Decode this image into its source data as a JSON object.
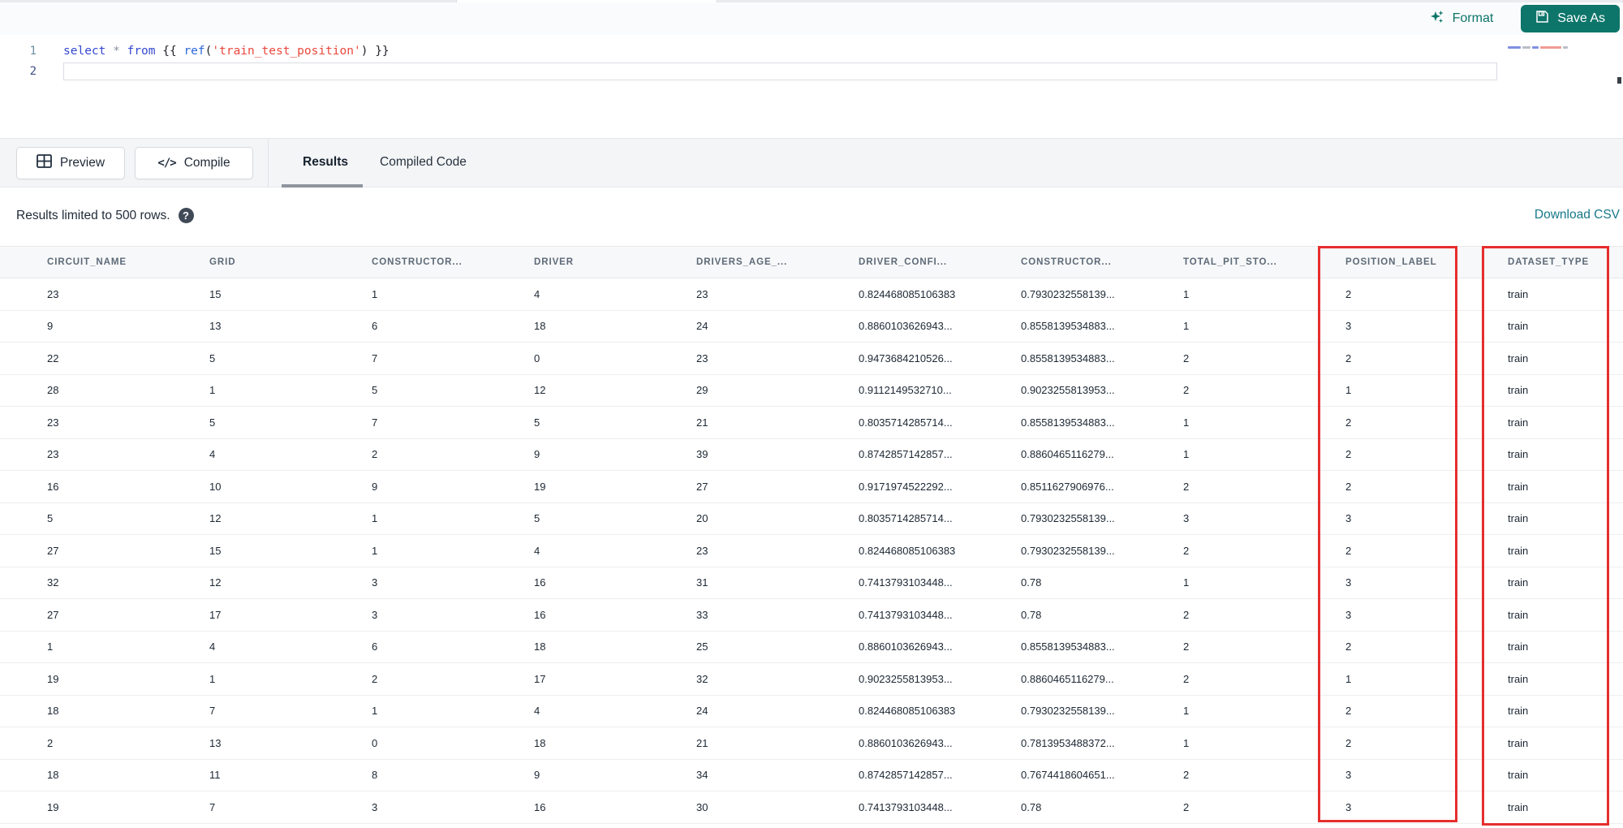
{
  "topbar": {
    "format_label": "Format",
    "save_as_label": "Save As"
  },
  "editor": {
    "line_numbers": [
      "1",
      "2"
    ],
    "code_text": "select * from {{ ref('train_test_position') }}",
    "code_tokens": [
      {
        "t": "select",
        "c": "keyword"
      },
      {
        "t": " ",
        "c": "plain"
      },
      {
        "t": "*",
        "c": "operator"
      },
      {
        "t": " ",
        "c": "plain"
      },
      {
        "t": "from",
        "c": "keyword"
      },
      {
        "t": " ",
        "c": "plain"
      },
      {
        "t": "{{ ",
        "c": "brace"
      },
      {
        "t": "ref",
        "c": "func"
      },
      {
        "t": "(",
        "c": "brace"
      },
      {
        "t": "'train_test_position'",
        "c": "string"
      },
      {
        "t": ") ",
        "c": "brace"
      },
      {
        "t": "}}",
        "c": "brace"
      }
    ]
  },
  "toolbar": {
    "preview_label": "Preview",
    "compile_label": "Compile",
    "compile_glyph": "</>",
    "tabs": [
      {
        "label": "Results",
        "active": true
      },
      {
        "label": "Compiled Code",
        "active": false
      }
    ]
  },
  "results_bar": {
    "limit_text": "Results limited to 500 rows.",
    "help_icon": "?",
    "download_csv_label": "Download CSV"
  },
  "table": {
    "columns": [
      "CIRCUIT_NAME",
      "GRID",
      "CONSTRUCTOR...",
      "DRIVER",
      "DRIVERS_AGE_...",
      "DRIVER_CONFI...",
      "CONSTRUCTOR...",
      "TOTAL_PIT_STO...",
      "POSITION_LABEL",
      "DATASET_TYPE"
    ],
    "rows": [
      [
        "23",
        "15",
        "1",
        "4",
        "23",
        "0.824468085106383",
        "0.7930232558139...",
        "1",
        "2",
        "train"
      ],
      [
        "9",
        "13",
        "6",
        "18",
        "24",
        "0.8860103626943...",
        "0.8558139534883...",
        "1",
        "3",
        "train"
      ],
      [
        "22",
        "5",
        "7",
        "0",
        "23",
        "0.9473684210526...",
        "0.8558139534883...",
        "2",
        "2",
        "train"
      ],
      [
        "28",
        "1",
        "5",
        "12",
        "29",
        "0.9112149532710...",
        "0.9023255813953...",
        "2",
        "1",
        "train"
      ],
      [
        "23",
        "5",
        "7",
        "5",
        "21",
        "0.8035714285714...",
        "0.8558139534883...",
        "1",
        "2",
        "train"
      ],
      [
        "23",
        "4",
        "2",
        "9",
        "39",
        "0.8742857142857...",
        "0.8860465116279...",
        "1",
        "2",
        "train"
      ],
      [
        "16",
        "10",
        "9",
        "19",
        "27",
        "0.9171974522292...",
        "0.8511627906976...",
        "2",
        "2",
        "train"
      ],
      [
        "5",
        "12",
        "1",
        "5",
        "20",
        "0.8035714285714...",
        "0.7930232558139...",
        "3",
        "3",
        "train"
      ],
      [
        "27",
        "15",
        "1",
        "4",
        "23",
        "0.824468085106383",
        "0.7930232558139...",
        "2",
        "2",
        "train"
      ],
      [
        "32",
        "12",
        "3",
        "16",
        "31",
        "0.7413793103448...",
        "0.78",
        "1",
        "3",
        "train"
      ],
      [
        "27",
        "17",
        "3",
        "16",
        "33",
        "0.7413793103448...",
        "0.78",
        "2",
        "3",
        "train"
      ],
      [
        "1",
        "4",
        "6",
        "18",
        "25",
        "0.8860103626943...",
        "0.8558139534883...",
        "2",
        "2",
        "train"
      ],
      [
        "19",
        "1",
        "2",
        "17",
        "32",
        "0.9023255813953...",
        "0.8860465116279...",
        "2",
        "1",
        "train"
      ],
      [
        "18",
        "7",
        "1",
        "4",
        "24",
        "0.824468085106383",
        "0.7930232558139...",
        "1",
        "2",
        "train"
      ],
      [
        "2",
        "13",
        "0",
        "18",
        "21",
        "0.8860103626943...",
        "0.7813953488372...",
        "1",
        "2",
        "train"
      ],
      [
        "18",
        "11",
        "8",
        "9",
        "34",
        "0.8742857142857...",
        "0.7674418604651...",
        "2",
        "3",
        "train"
      ],
      [
        "19",
        "7",
        "3",
        "16",
        "30",
        "0.7413793103448...",
        "0.78",
        "2",
        "3",
        "train"
      ]
    ]
  },
  "annotations": {
    "highlight_color": "#e62e2e",
    "highlighted_columns": [
      "POSITION_LABEL",
      "DATASET_TYPE"
    ]
  },
  "colors": {
    "accent_teal": "#0d756a",
    "link_teal": "#17778a",
    "annotation_red": "#e62e2e",
    "code_keyword": "#3347cf",
    "code_string": "#e8473c"
  }
}
